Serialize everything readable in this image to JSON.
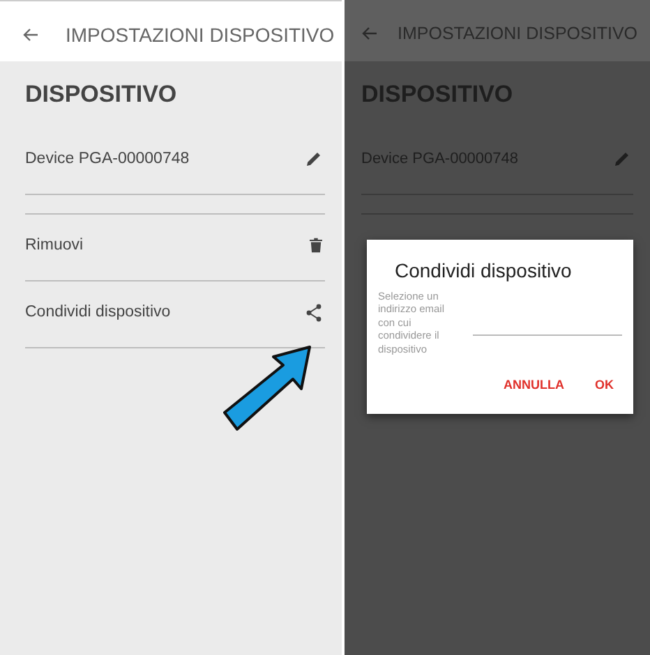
{
  "screens": [
    {
      "dimmed": false,
      "header": {
        "title": "IMPOSTAZIONI DISPOSITIVO"
      },
      "section_title": "DISPOSITIVO",
      "rows": [
        {
          "kind": "edit",
          "label": "Device PGA-00000748"
        },
        {
          "kind": "empty"
        },
        {
          "kind": "delete",
          "label": "Rimuovi"
        },
        {
          "kind": "share",
          "label": "Condividi dispositivo"
        }
      ]
    },
    {
      "dimmed": true,
      "header": {
        "title": "IMPOSTAZIONI DISPOSITIVO"
      },
      "section_title": "DISPOSITIVO",
      "rows": [
        {
          "kind": "edit",
          "label": "Device PGA-00000748"
        },
        {
          "kind": "empty"
        }
      ]
    }
  ],
  "dialog": {
    "title": "Condividi dispositivo",
    "field": {
      "label": "Selezione un indirizzo email con cui condividere il dispositivo"
    },
    "buttons": [
      "ANNULLA",
      "OK"
    ]
  }
}
